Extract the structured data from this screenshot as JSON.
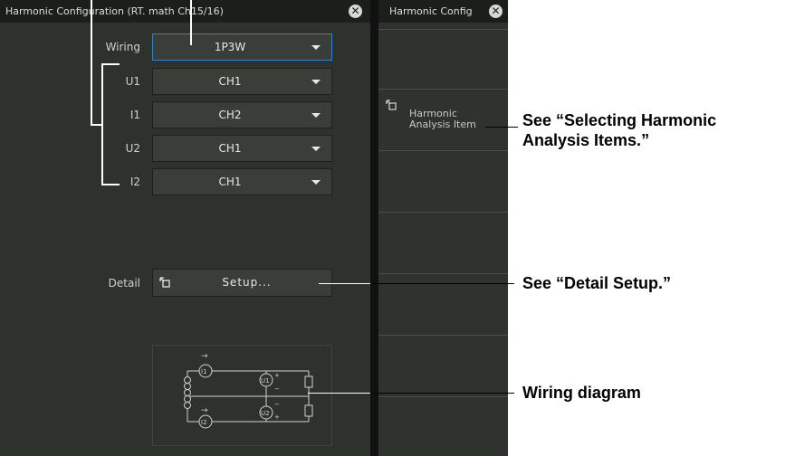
{
  "left_panel": {
    "title": "Harmonic Configuration (RT. math Ch15/16)",
    "rows": [
      {
        "label": "Wiring",
        "value": "1P3W"
      },
      {
        "label": "U1",
        "value": "CH1"
      },
      {
        "label": "I1",
        "value": "CH2"
      },
      {
        "label": "U2",
        "value": "CH1"
      },
      {
        "label": "I2",
        "value": "CH1"
      }
    ],
    "detail_label": "Detail",
    "setup_label": "Setup..."
  },
  "right_panel": {
    "title": "Harmonic Config",
    "item_line1": "Harmonic",
    "item_line2": "Analysis Item"
  },
  "diagram": {
    "i1": "I1",
    "i2": "I2",
    "u1": "U1",
    "u2": "U2",
    "plus": "+",
    "minus": "−",
    "arrow": "→"
  },
  "callouts": {
    "selecting_line1": "See “Selecting Harmonic",
    "selecting_line2": "Analysis Items.”",
    "detail_setup": "See “Detail Setup.”",
    "wiring_diagram": "Wiring diagram"
  },
  "colors": {
    "panel_bg": "#2e322d",
    "titlebar_bg": "#1c1e1c",
    "active_border": "#3a7fc8"
  }
}
